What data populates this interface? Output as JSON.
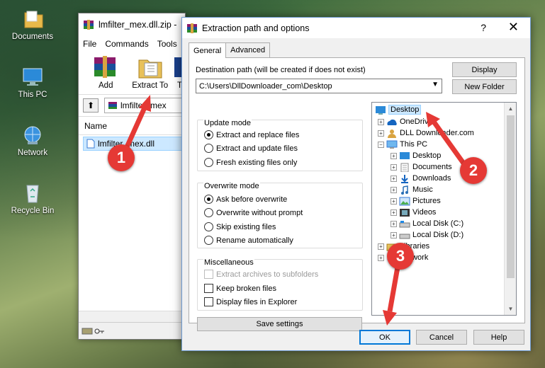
{
  "desktop": {
    "icons": [
      {
        "label": "Documents",
        "icon": "folder-icon"
      },
      {
        "label": "This PC",
        "icon": "computer-icon"
      },
      {
        "label": "Network",
        "icon": "network-icon"
      },
      {
        "label": "Recycle Bin",
        "icon": "recycle-bin-icon"
      }
    ]
  },
  "winrar": {
    "title": "lmfilter_mex.dll.zip -",
    "menu": [
      "File",
      "Commands",
      "Tools"
    ],
    "tools": [
      {
        "label": "Add",
        "icon": "add-archive-icon"
      },
      {
        "label": "Extract To",
        "icon": "extract-to-icon"
      },
      {
        "label": "T",
        "icon": "test-icon"
      }
    ],
    "path": "lmfilter_mex",
    "column_name": "Name",
    "file": "lmfilter_mex.dll"
  },
  "dialog": {
    "title": "Extraction path and options",
    "help": "?",
    "close": "✕",
    "tabs": [
      "General",
      "Advanced"
    ],
    "dest_label": "Destination path (will be created if does not exist)",
    "dest_value": "C:\\Users\\DllDownloader_com\\Desktop",
    "display_button": "Display",
    "new_folder_button": "New Folder",
    "update_mode": {
      "title": "Update mode",
      "options": [
        "Extract and replace files",
        "Extract and update files",
        "Fresh existing files only"
      ],
      "selected": 0
    },
    "overwrite_mode": {
      "title": "Overwrite mode",
      "options": [
        "Ask before overwrite",
        "Overwrite without prompt",
        "Skip existing files",
        "Rename automatically"
      ],
      "selected": 0
    },
    "misc": {
      "title": "Miscellaneous",
      "options": [
        "Extract archives to subfolders",
        "Keep broken files",
        "Display files in Explorer"
      ]
    },
    "save_settings": "Save settings",
    "tree": [
      {
        "label": "Desktop",
        "icon": "desktop-icon",
        "selected": true
      },
      {
        "label": "OneDrive",
        "icon": "onedrive-icon"
      },
      {
        "label": "DLL Downloader.com",
        "icon": "user-icon"
      },
      {
        "label": "This PC",
        "icon": "computer-icon"
      },
      {
        "label": "Desktop",
        "icon": "desktop-icon"
      },
      {
        "label": "Documents",
        "icon": "documents-icon"
      },
      {
        "label": "Downloads",
        "icon": "downloads-icon"
      },
      {
        "label": "Music",
        "icon": "music-icon"
      },
      {
        "label": "Pictures",
        "icon": "pictures-icon"
      },
      {
        "label": "Videos",
        "icon": "videos-icon"
      },
      {
        "label": "Local Disk (C:)",
        "icon": "disk-icon"
      },
      {
        "label": "Local Disk (D:)",
        "icon": "disk-icon"
      },
      {
        "label": "Libraries",
        "icon": "libraries-icon"
      },
      {
        "label": "Network",
        "icon": "network-icon"
      }
    ],
    "ok": "OK",
    "cancel": "Cancel",
    "help_button": "Help"
  },
  "annotations": [
    "1",
    "2",
    "3"
  ],
  "colors": {
    "badge": "#e53935",
    "accent": "#0078d7",
    "selection": "#cce8ff"
  }
}
